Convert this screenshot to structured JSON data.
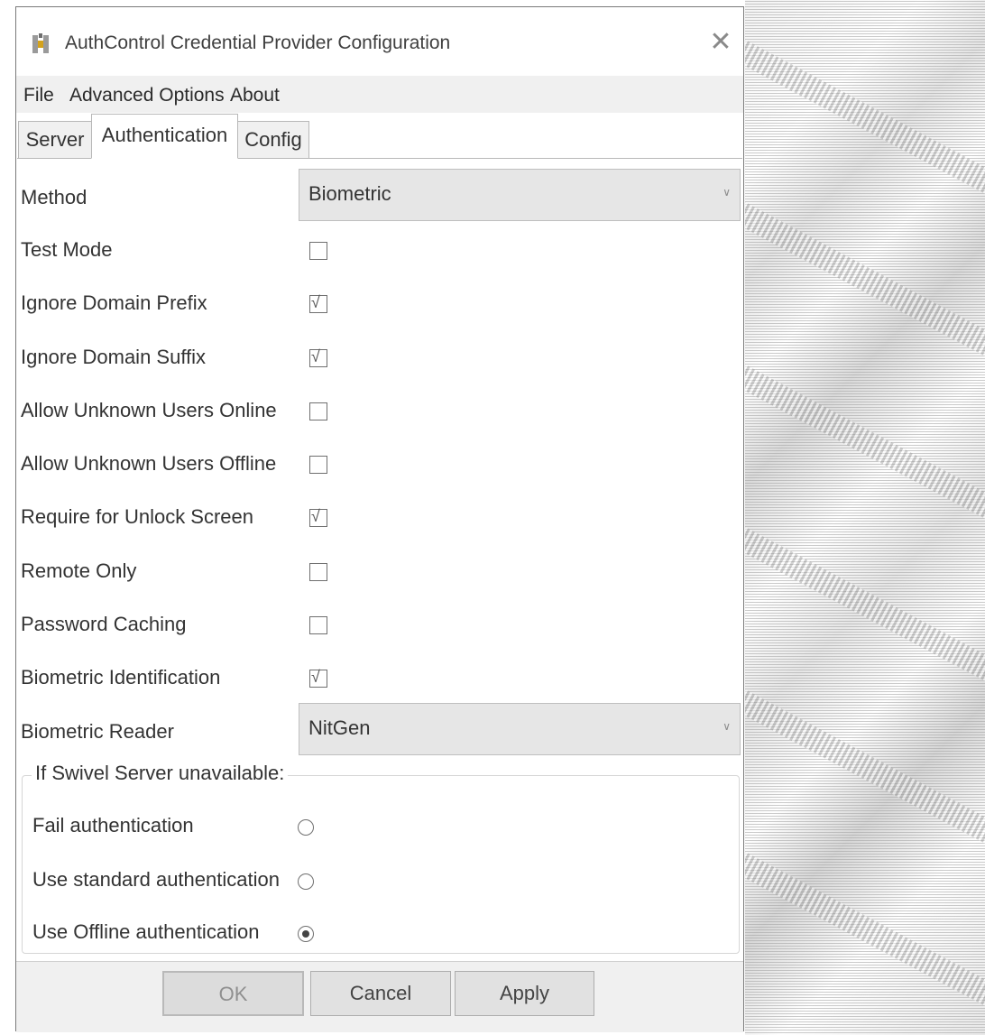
{
  "window": {
    "title": "AuthControl Credential Provider Configuration",
    "close_glyph": "✕",
    "icon": "authcontrol-app-icon"
  },
  "menu": [
    "File",
    "Advanced Options",
    "About"
  ],
  "tabs": [
    {
      "label": "Server",
      "active": false
    },
    {
      "label": "Authentication",
      "active": true
    },
    {
      "label": "Config",
      "active": false
    }
  ],
  "form": {
    "method": {
      "label": "Method",
      "value": "Biometric"
    },
    "options": [
      {
        "label": "Test Mode",
        "checked": false
      },
      {
        "label": "Ignore Domain Prefix",
        "checked": true
      },
      {
        "label": "Ignore Domain Suffix",
        "checked": true
      },
      {
        "label": "Allow Unknown Users Online",
        "checked": false
      },
      {
        "label": "Allow Unknown Users Offline",
        "checked": false
      },
      {
        "label": "Require for Unlock Screen",
        "checked": true
      },
      {
        "label": "Remote Only",
        "checked": false
      },
      {
        "label": "Password Caching",
        "checked": false
      },
      {
        "label": "Biometric Identification",
        "checked": true
      }
    ],
    "biometric_reader": {
      "label": "Biometric Reader",
      "value": "NitGen"
    },
    "chevron_glyph": "∨",
    "check_glyph": "√"
  },
  "fallback_group": {
    "legend": "If Swivel Server unavailable:",
    "options": [
      {
        "label": "Fail authentication",
        "selected": false
      },
      {
        "label": "Use standard authentication",
        "selected": false
      },
      {
        "label": "Use Offline authentication",
        "selected": true
      }
    ]
  },
  "buttons": {
    "ok": "OK",
    "cancel": "Cancel",
    "apply": "Apply"
  },
  "colors": {
    "menubar_bg": "#f0f0f0",
    "select_bg": "#e6e6e6",
    "button_bg": "#e1e1e1"
  }
}
